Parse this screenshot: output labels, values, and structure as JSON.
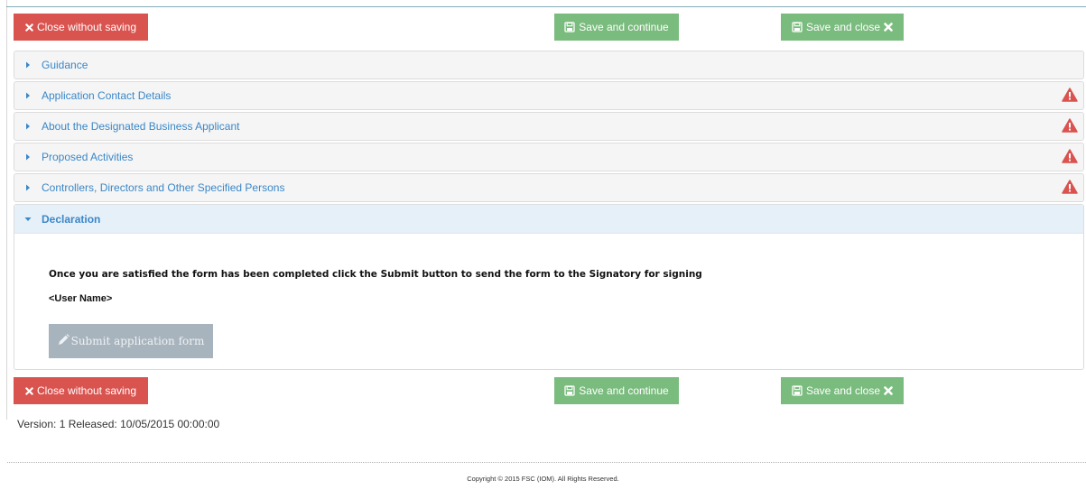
{
  "toolbar_top": {
    "close_label": "Close without saving",
    "save_continue_label": "Save and continue",
    "save_close_label": "Save and close"
  },
  "sections": [
    {
      "title": "Guidance",
      "warning": false
    },
    {
      "title": "Application Contact Details",
      "warning": true
    },
    {
      "title": "About the Designated Business Applicant",
      "warning": true
    },
    {
      "title": "Proposed Activities",
      "warning": true
    },
    {
      "title": "Controllers, Directors and Other Specified Persons",
      "warning": true
    }
  ],
  "declaration": {
    "title": "Declaration",
    "instruction": "Once you are satisfied the form has been completed click the Submit button to send the form to the Signatory for signing",
    "user_name": "<User Name>",
    "submit_label": "Submit application form"
  },
  "toolbar_bottom": {
    "close_label": "Close without saving",
    "save_continue_label": "Save and continue",
    "save_close_label": "Save and close"
  },
  "version_text": "Version: 1 Released: 10/05/2015 00:00:00",
  "copyright": "Copyright © 2015 FSC (IOM). All Rights Reserved.",
  "colors": {
    "danger": "#d9534f",
    "success": "#7abb7e",
    "link": "#3a87c8",
    "warning_icon": "#d9534f",
    "disabled": "#a8b4bd"
  }
}
